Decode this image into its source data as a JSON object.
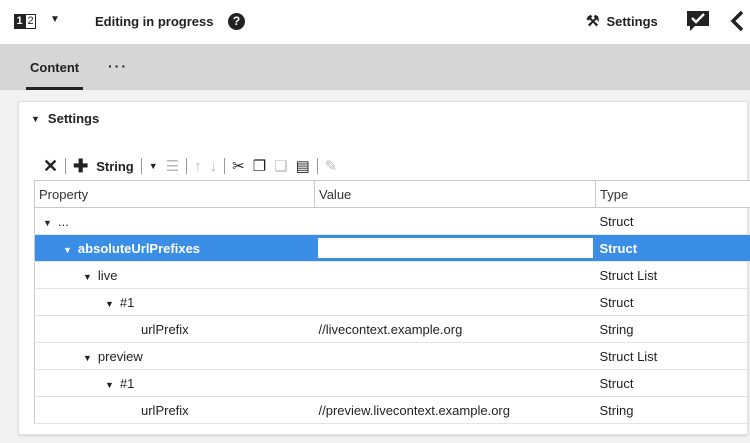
{
  "header": {
    "lang_digit_1": "1",
    "lang_digit_2": "2",
    "status_title": "Editing in progress",
    "help_glyph": "?",
    "settings_label": "Settings"
  },
  "tabs": {
    "content_label": "Content",
    "more_label": "···"
  },
  "panel": {
    "title": "Settings"
  },
  "toolbar": {
    "add_type_label": "String"
  },
  "table": {
    "columns": [
      "Property",
      "Value",
      "Type"
    ],
    "rows": [
      {
        "property": "...",
        "value": "",
        "type": "Struct",
        "expanded": true,
        "level": 0,
        "selected": false
      },
      {
        "property": "absoluteUrlPrefixes",
        "value": "",
        "type": "Struct",
        "expanded": true,
        "level": 1,
        "selected": true
      },
      {
        "property": "live",
        "value": "",
        "type": "Struct List",
        "expanded": true,
        "level": 2,
        "selected": false
      },
      {
        "property": "#1",
        "value": "",
        "type": "Struct",
        "expanded": true,
        "level": 3,
        "selected": false
      },
      {
        "property": "urlPrefix",
        "value": "//livecontext.example.org",
        "type": "String",
        "expanded": false,
        "level": 4,
        "selected": false
      },
      {
        "property": "preview",
        "value": "",
        "type": "Struct List",
        "expanded": true,
        "level": 2,
        "selected": false
      },
      {
        "property": "#1",
        "value": "",
        "type": "Struct",
        "expanded": true,
        "level": 3,
        "selected": false
      },
      {
        "property": "urlPrefix",
        "value": "//preview.livecontext.example.org",
        "type": "String",
        "expanded": false,
        "level": 4,
        "selected": false
      }
    ]
  },
  "colors": {
    "accent": "#3a8ee6",
    "tab_strip": "#d6d6d6",
    "disabled_icon": "#b9b9b9"
  }
}
